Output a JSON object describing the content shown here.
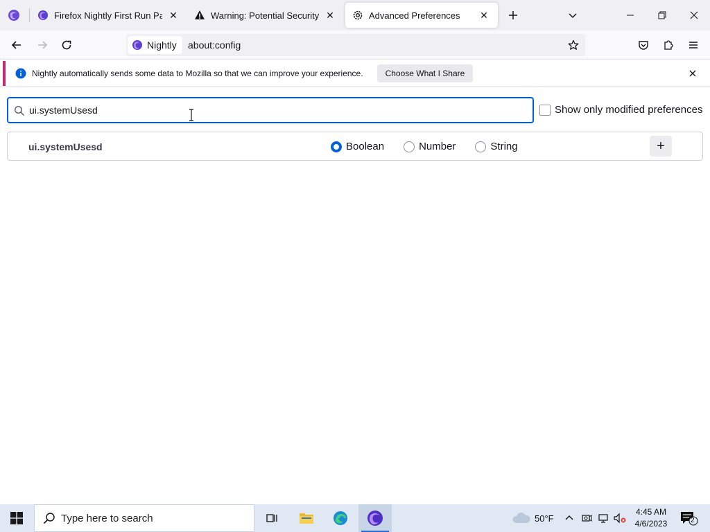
{
  "tabs": [
    {
      "label": "Firefox Nightly First Run Page",
      "icon": "nightly-icon"
    },
    {
      "label": "Warning: Potential Security Risk Ahead",
      "icon": "warning-icon"
    },
    {
      "label": "Advanced Preferences",
      "icon": "gear-icon",
      "active": true
    }
  ],
  "navbar": {
    "identity_label": "Nightly",
    "url": "about:config"
  },
  "notification": {
    "message": "Nightly automatically sends some data to Mozilla so that we can improve your experience.",
    "button": "Choose What I Share"
  },
  "config": {
    "search_value": "ui.systemUsesd",
    "show_modified_label": "Show only modified preferences",
    "new_pref_name": "ui.systemUsesd",
    "types": [
      "Boolean",
      "Number",
      "String"
    ],
    "selected_type": "Boolean",
    "add_button": "+"
  },
  "taskbar": {
    "search_placeholder": "Type here to search",
    "weather": "50°F",
    "time": "4:45 AM",
    "date": "4/6/2023",
    "notification_count": "2"
  },
  "colors": {
    "accent": "#0061e0",
    "notification_border": "#c02c71"
  }
}
